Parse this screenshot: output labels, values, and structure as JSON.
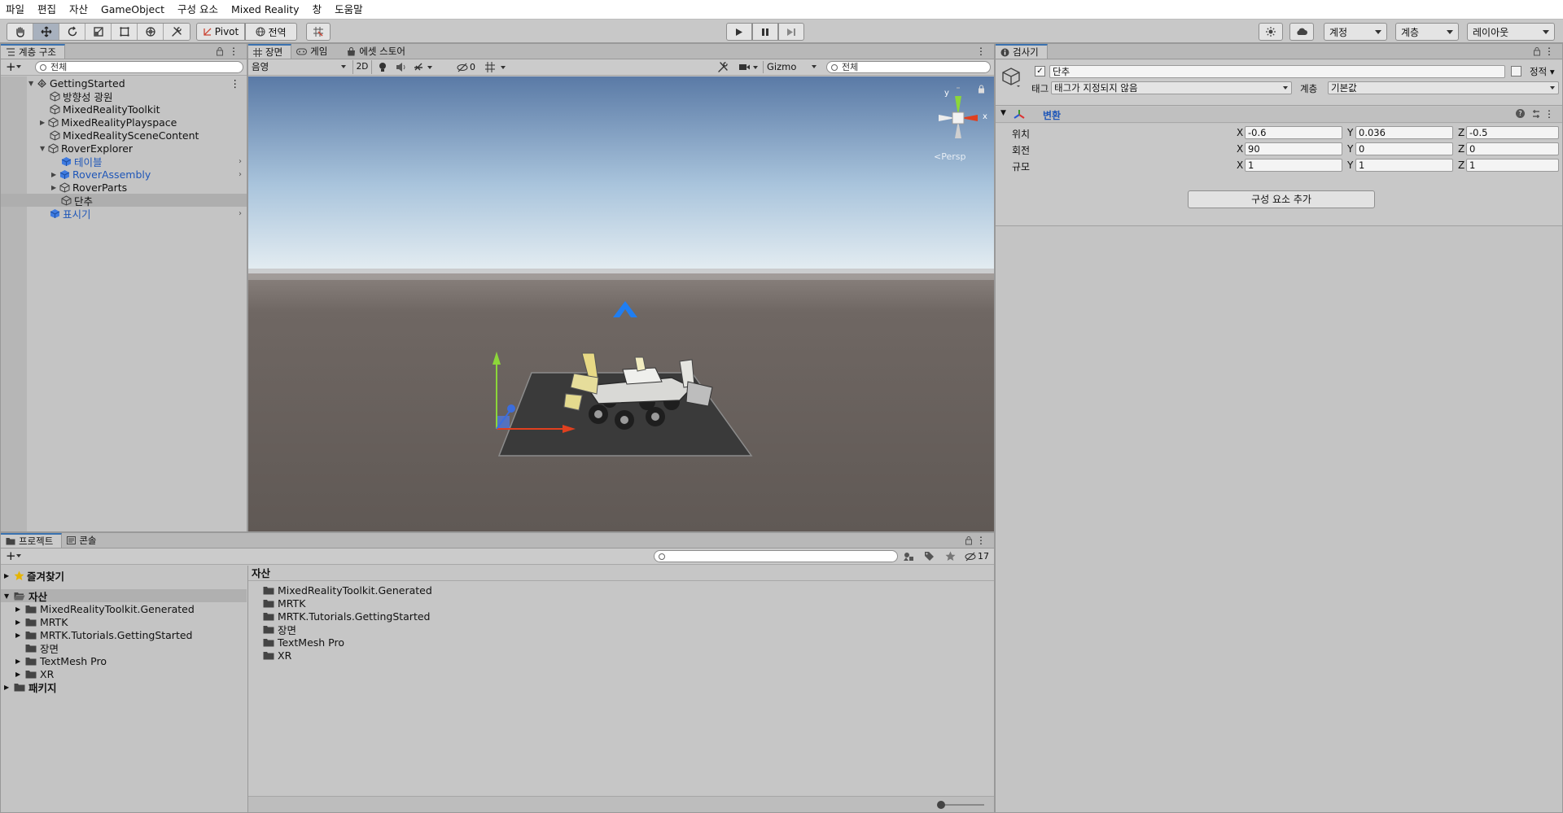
{
  "menu": [
    "파일",
    "편집",
    "자산",
    "GameObject",
    "구성 요소",
    "Mixed Reality",
    "창",
    "도움말"
  ],
  "toolbar": {
    "pivot_label": "Pivot",
    "global_label": "전역",
    "account_label": "계정",
    "layers_label": "계층",
    "layout_label": "레이아웃"
  },
  "hierarchy": {
    "tab_label": "계층 구조",
    "search_placeholder": "전체",
    "items": [
      {
        "label": "GettingStarted"
      },
      {
        "label": "방향성 광원"
      },
      {
        "label": "MixedRealityToolkit"
      },
      {
        "label": "MixedRealityPlayspace"
      },
      {
        "label": "MixedRealitySceneContent"
      },
      {
        "label": "RoverExplorer"
      },
      {
        "label": "테이블"
      },
      {
        "label": "RoverAssembly"
      },
      {
        "label": "RoverParts"
      },
      {
        "label": "단추"
      },
      {
        "label": "표시기"
      }
    ]
  },
  "scene": {
    "tabs": [
      "장면",
      "게임",
      "에셋 스토어"
    ],
    "shading_label": "음영",
    "mode_2d": "2D",
    "hidden_count": "0",
    "gizmo_label": "Gizmo",
    "search_placeholder": "전체",
    "persp_label": "<Persp",
    "axis_x": "x",
    "axis_y": "y"
  },
  "inspector": {
    "tab_label": "검사기",
    "object_name": "단추",
    "static_label": "정적",
    "tag_label": "태그",
    "tag_value": "태그가 지정되지 않음",
    "layer_label": "계층",
    "layer_value": "기본값",
    "component_title": "변환",
    "rows": [
      {
        "label": "위치",
        "x": "-0.6",
        "y": "0.036",
        "z": "-0.5"
      },
      {
        "label": "회전",
        "x": "90",
        "y": "0",
        "z": "0"
      },
      {
        "label": "규모",
        "x": "1",
        "y": "1",
        "z": "1"
      }
    ],
    "axis_x": "X",
    "axis_y": "Y",
    "axis_z": "Z",
    "add_component_label": "구성 요소 추가"
  },
  "project": {
    "tabs": [
      "프로젝트",
      "콘솔"
    ],
    "hidden_count": "17",
    "favorites_label": "즐겨찾기",
    "assets_label": "자산",
    "tree": [
      "MixedRealityToolkit.Generated",
      "MRTK",
      "MRTK.Tutorials.GettingStarted",
      "장면",
      "TextMesh Pro",
      "XR"
    ],
    "packages_label": "패키지",
    "header": "자산",
    "files": [
      "MixedRealityToolkit.Generated",
      "MRTK",
      "MRTK.Tutorials.GettingStarted",
      "장면",
      "TextMesh Pro",
      "XR"
    ]
  },
  "colors": {
    "accent": "#3a72b0",
    "prefab_blue": "#1e56b8",
    "sky_top": "#5a7aa6",
    "ground": "#6b6360"
  }
}
